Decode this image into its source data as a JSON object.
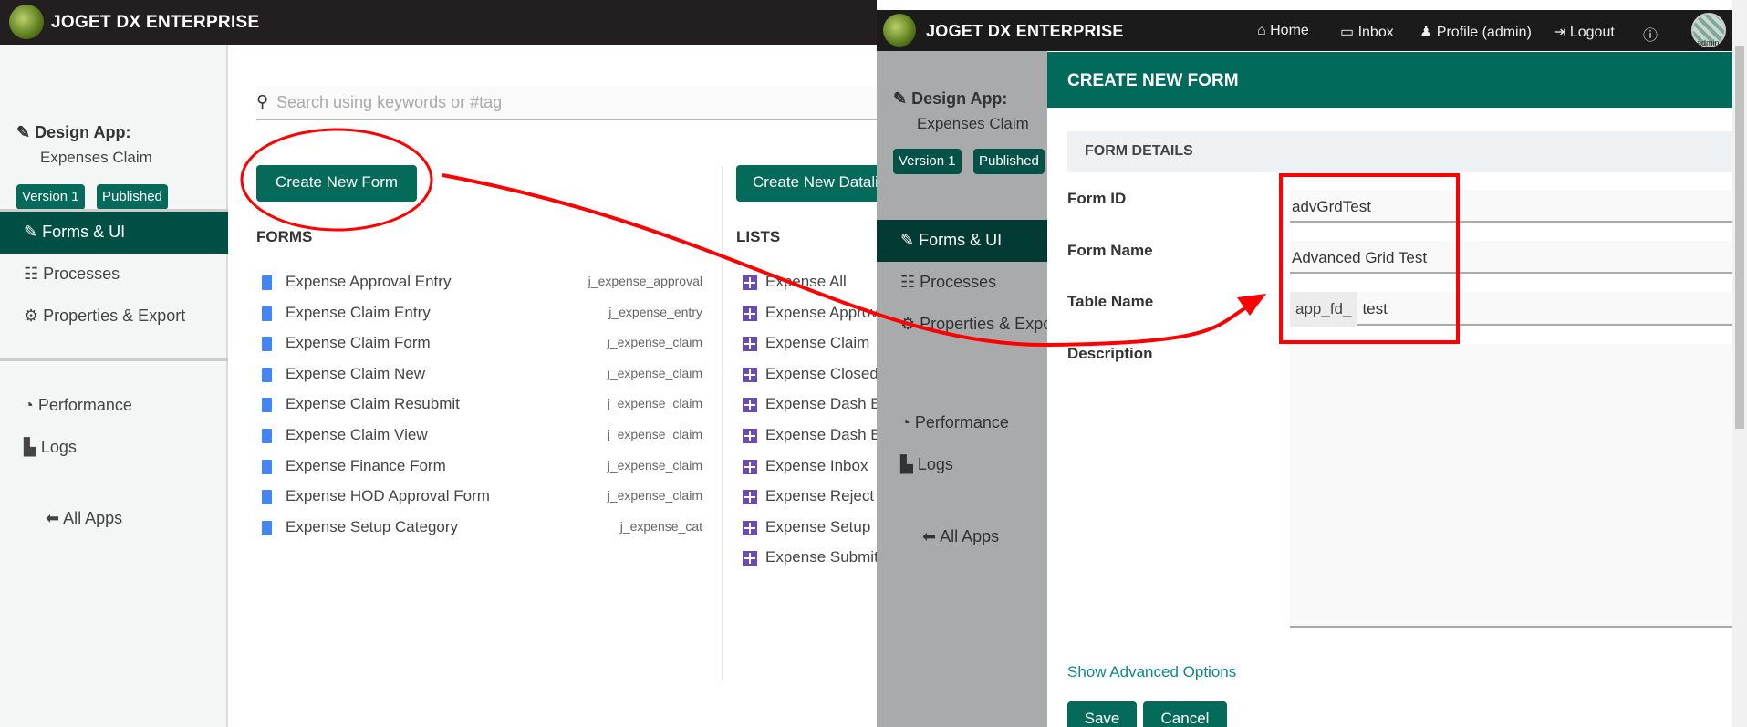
{
  "brand": "JOGET DX ENTERPRISE",
  "left": {
    "design_label": "Design App:",
    "app_name": "Expenses Claim",
    "version": "Version 1",
    "status": "Published",
    "nav": [
      "Forms & UI",
      "Processes",
      "Properties & Export",
      "Performance",
      "Logs",
      "All Apps"
    ],
    "search_placeholder": "Search using keywords or #tag",
    "create_form": "Create New Form",
    "create_list": "Create New Datalist",
    "forms_heading": "FORMS",
    "lists_heading": "LISTS",
    "forms": [
      {
        "name": "Expense Approval Entry",
        "id": "j_expense_approval"
      },
      {
        "name": "Expense Claim Entry",
        "id": "j_expense_entry"
      },
      {
        "name": "Expense Claim Form",
        "id": "j_expense_claim"
      },
      {
        "name": "Expense Claim New",
        "id": "j_expense_claim"
      },
      {
        "name": "Expense Claim Resubmit",
        "id": "j_expense_claim"
      },
      {
        "name": "Expense Claim View",
        "id": "j_expense_claim"
      },
      {
        "name": "Expense Finance Form",
        "id": "j_expense_claim"
      },
      {
        "name": "Expense HOD Approval Form",
        "id": "j_expense_claim"
      },
      {
        "name": "Expense Setup Category",
        "id": "j_expense_cat"
      }
    ],
    "lists": [
      "Expense All",
      "Expense Approval",
      "Expense Claim",
      "Expense Closed",
      "Expense Dash Board",
      "Expense Dash Board",
      "Expense Inbox",
      "Expense Reject",
      "Expense Setup",
      "Expense Submitted"
    ]
  },
  "right": {
    "topnav": [
      "Home",
      "Inbox",
      "Profile (admin)",
      "Logout"
    ],
    "avatar_label": "admin",
    "modal_title": "CREATE NEW FORM",
    "section": "FORM DETAILS",
    "form_id_label": "Form ID",
    "form_id": "advGrdTest",
    "form_name_label": "Form Name",
    "form_name": "Advanced Grid Test",
    "table_name_label": "Table Name",
    "table_prefix": "app_fd_",
    "table_name": "test",
    "description_label": "Description",
    "advanced": "Show Advanced Options",
    "save": "Save",
    "cancel": "Cancel"
  },
  "annotation_color": "#ff0000"
}
